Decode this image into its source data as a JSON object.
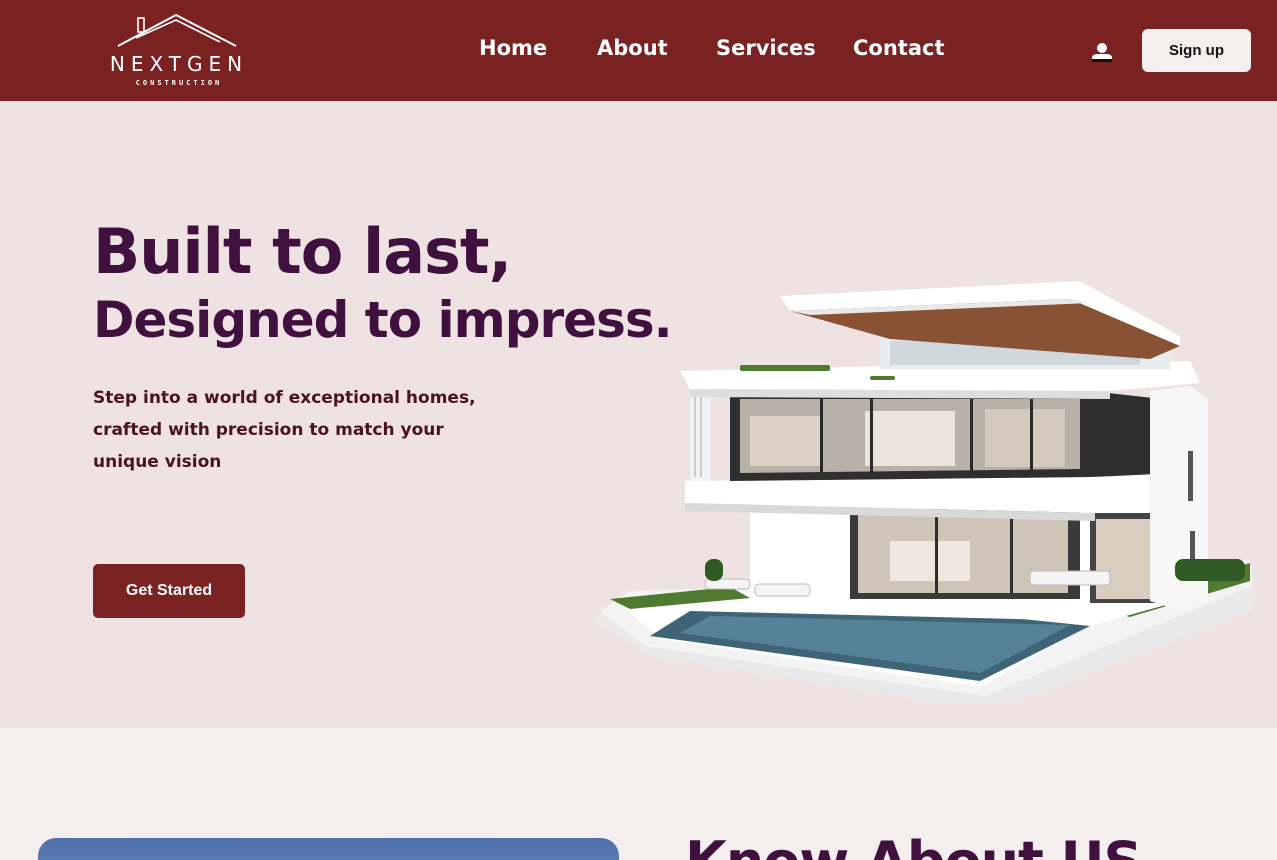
{
  "brand": {
    "name": "NEXTGEN",
    "tagline": "CONSTRUCTION"
  },
  "nav": {
    "items": [
      {
        "label": "Home"
      },
      {
        "label": "About"
      },
      {
        "label": "Services"
      },
      {
        "label": "Contact"
      }
    ],
    "user_icon": "user-icon",
    "signup_label": "Sign up"
  },
  "hero": {
    "title_line1": "Built to last,",
    "title_line2": "Designed to impress.",
    "subtitle": "Step into a world of exceptional homes, crafted with precision to match your unique vision",
    "cta_label": "Get Started"
  },
  "about": {
    "heading": "Know About US"
  },
  "colors": {
    "header_bg": "#7a2222",
    "hero_bg": "#efe2e2",
    "heading_text": "#40103e",
    "button_bg": "#7a2222"
  }
}
